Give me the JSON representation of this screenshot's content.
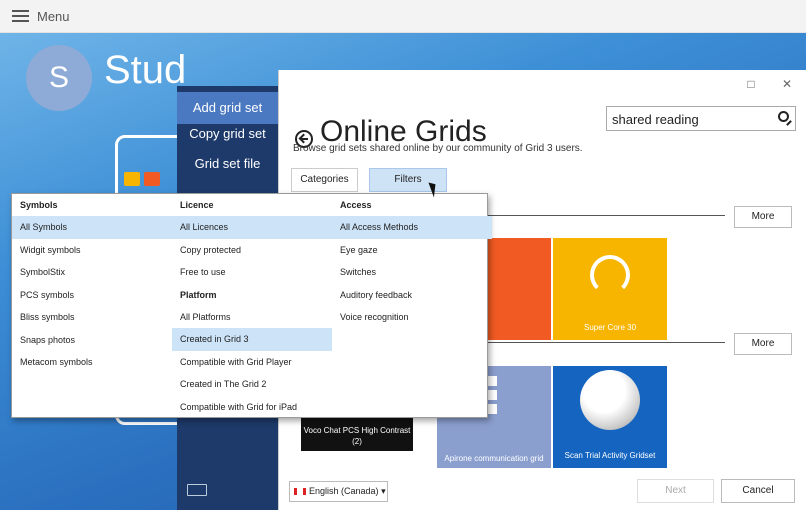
{
  "menubar": {
    "label": "Menu"
  },
  "user": {
    "initial": "S",
    "name": "Stud"
  },
  "side_menu": {
    "items": [
      "Add grid set",
      "Copy grid set",
      "Grid set file"
    ]
  },
  "dialog": {
    "title": "Online Grids",
    "subtitle": "Browse grid sets shared online by our community of Grid 3 users.",
    "search": {
      "value": "shared reading"
    },
    "tabs": [
      "Categories",
      "Filters"
    ],
    "more_label": "More",
    "cards_row1": [
      {
        "label": "re 50",
        "color": "#f15a22"
      },
      {
        "label": "Super Core 30",
        "color": "#f7b500"
      }
    ],
    "cards_row2": [
      {
        "label": "Voco Chat PCS High Contrast (2)",
        "color": "#111111"
      },
      {
        "label": "Apirone communication grid",
        "color": "#8b9fcf"
      },
      {
        "label": "Scan Trial Activity Gridset",
        "color": "#1565c0"
      }
    ],
    "language": "English (Canada)",
    "next_label": "Next",
    "cancel_label": "Cancel",
    "window_controls": [
      "□",
      "✕"
    ]
  },
  "filters": {
    "columns": [
      {
        "heading": "Symbols",
        "items": [
          "All Symbols",
          "Widgit symbols",
          "SymbolStix",
          "PCS symbols",
          "Bliss symbols",
          "Snaps photos",
          "Metacom symbols"
        ],
        "selected": [
          0
        ]
      },
      {
        "heading": "Licence",
        "items": [
          "All Licences",
          "Copy protected",
          "Free to use"
        ],
        "selected": [
          0
        ],
        "heading2": "Platform",
        "items2": [
          "All Platforms",
          "Created in Grid 3",
          "Compatible with Grid Player",
          "Created in The Grid 2",
          "Compatible with Grid for iPad"
        ],
        "selected2": [
          1
        ]
      },
      {
        "heading": "Access",
        "items": [
          "All Access Methods",
          "Eye gaze",
          "Switches",
          "Auditory feedback",
          "Voice recognition"
        ],
        "selected": [
          0
        ]
      }
    ]
  },
  "colors": {
    "accent_blue": "#2a6fbf",
    "dark_menu": "#1d3a6a",
    "menu_active": "#4b79c1",
    "selected_row": "#cde3f7"
  }
}
